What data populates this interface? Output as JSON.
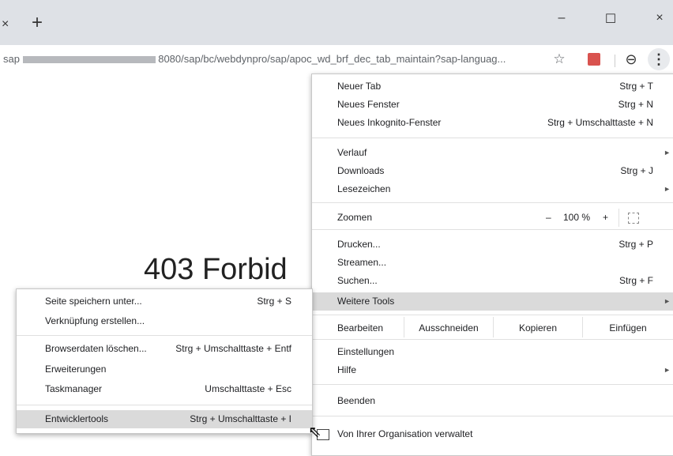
{
  "window": {
    "tab_close_glyph": "×",
    "new_tab_glyph": "+",
    "minimize_glyph": "–",
    "maximize_glyph": "☐",
    "close_glyph": "×"
  },
  "toolbar": {
    "url_prefix": "sap",
    "url_suffix": "8080/sap/bc/webdynpro/sap/apoc_wd_brf_dec_tab_maintain?sap-languag...",
    "star_glyph": "☆",
    "profile_glyph": "⊖",
    "menu_glyph": "⋮"
  },
  "content": {
    "page_text": "403 Forbid"
  },
  "menu": {
    "items": [
      {
        "label": "Neuer Tab",
        "shortcut": "Strg + T"
      },
      {
        "label": "Neues Fenster",
        "shortcut": "Strg + N"
      },
      {
        "label": "Neues Inkognito-Fenster",
        "shortcut": "Strg + Umschalttaste + N"
      },
      {
        "label": "Verlauf",
        "shortcut": ""
      },
      {
        "label": "Downloads",
        "shortcut": "Strg + J"
      },
      {
        "label": "Lesezeichen",
        "shortcut": ""
      },
      {
        "label": "Zoomen",
        "shortcut": ""
      },
      {
        "label": "Drucken...",
        "shortcut": "Strg + P"
      },
      {
        "label": "Streamen...",
        "shortcut": ""
      },
      {
        "label": "Suchen...",
        "shortcut": "Strg + F"
      },
      {
        "label": "Weitere Tools",
        "shortcut": ""
      },
      {
        "label": "Einstellungen",
        "shortcut": ""
      },
      {
        "label": "Hilfe",
        "shortcut": ""
      },
      {
        "label": "Beenden",
        "shortcut": ""
      },
      {
        "label": "Von Ihrer Organisation verwaltet",
        "shortcut": ""
      }
    ],
    "zoom": {
      "minus": "–",
      "value": "100 %",
      "plus": "+"
    },
    "edit": {
      "label": "Bearbeiten",
      "cut": "Ausschneiden",
      "copy": "Kopieren",
      "paste": "Einfügen"
    },
    "arrow_glyph": "►"
  },
  "submenu": {
    "items": [
      {
        "label": "Seite speichern unter...",
        "shortcut": "Strg + S"
      },
      {
        "label": "Verknüpfung erstellen...",
        "shortcut": ""
      },
      {
        "label": "Browserdaten löschen...",
        "shortcut": "Strg + Umschalttaste + Entf"
      },
      {
        "label": "Erweiterungen",
        "shortcut": ""
      },
      {
        "label": "Taskmanager",
        "shortcut": "Umschalttaste + Esc"
      },
      {
        "label": "Entwicklertools",
        "shortcut": "Strg + Umschalttaste + I"
      }
    ]
  }
}
